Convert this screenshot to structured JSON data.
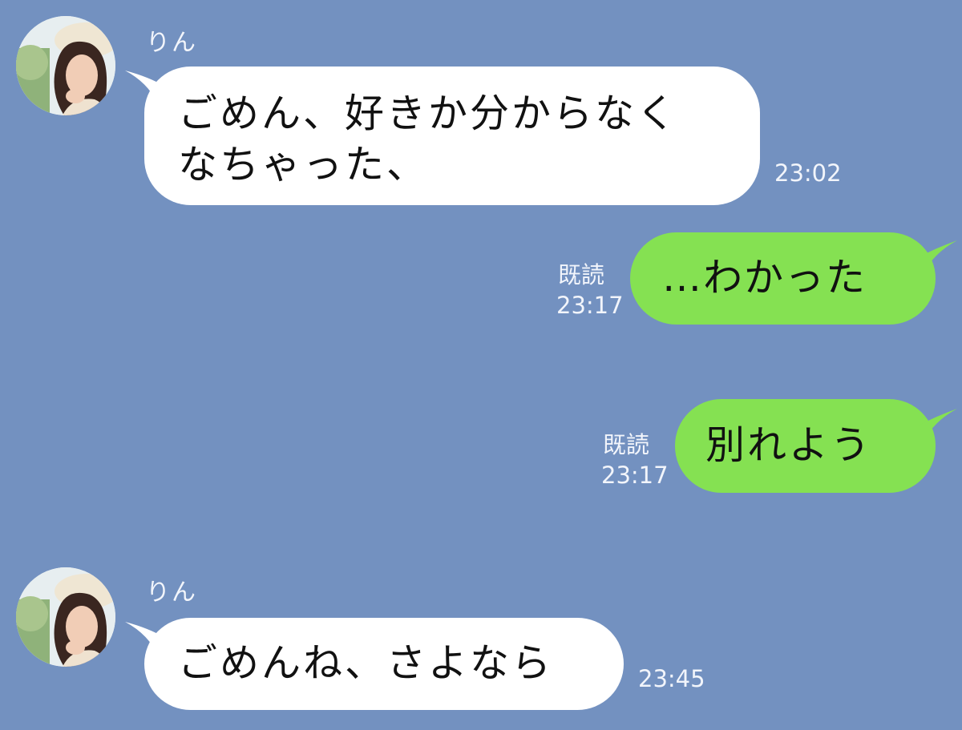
{
  "colors": {
    "background": "#7391c0",
    "incoming_bubble": "#ffffff",
    "outgoing_bubble": "#85e152",
    "meta_text": "#f2f5fb"
  },
  "messages": [
    {
      "direction": "incoming",
      "sender": "りん",
      "avatar": "profile-photo",
      "text": "ごめん、好きか分からなく\nなちゃった、",
      "time": "23:02"
    },
    {
      "direction": "outgoing",
      "read_label": "既読",
      "time": "23:17",
      "text": "…わかった"
    },
    {
      "direction": "outgoing",
      "read_label": "既読",
      "time": "23:17",
      "text": "別れよう"
    },
    {
      "direction": "incoming",
      "sender": "りん",
      "avatar": "profile-photo",
      "text": "ごめんね、さよなら",
      "time": "23:45"
    }
  ]
}
